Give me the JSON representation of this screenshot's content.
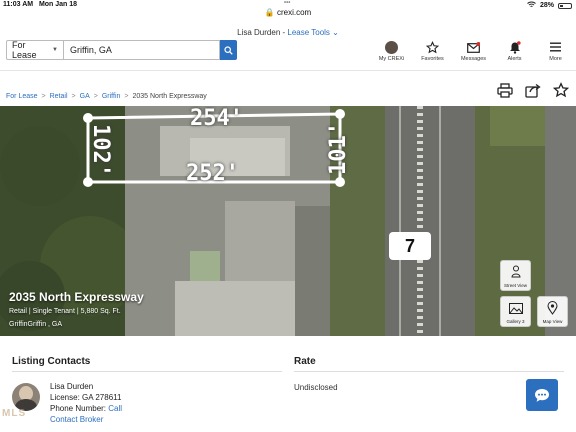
{
  "status_bar": {
    "time": "11:03 AM",
    "date": "Mon Jan 18",
    "url": "crexi.com",
    "battery": "28%"
  },
  "user_bar": {
    "name": "Lisa Durden",
    "sep": " - ",
    "tools": "Lease Tools"
  },
  "search": {
    "mode": "For Lease",
    "location_value": "Griffin, GA"
  },
  "nav": {
    "my_crexi": "My CREXi",
    "favorites": "Favorites",
    "messages": "Messages",
    "alerts": "Alerts",
    "more": "More"
  },
  "breadcrumb": {
    "items": [
      "For Lease",
      "Retail",
      "GA",
      "Griffin"
    ],
    "current": "2035 North Expressway"
  },
  "hero": {
    "dims": [
      "254'",
      "102'",
      "101'",
      "252'"
    ],
    "highway_shield": "7",
    "title": "2035 North Expressway",
    "subtitle": "Retail | Single Tenant | 5,880 Sq. Ft.",
    "location": "GriffinGriffin , GA",
    "street_view": "Street View",
    "gallery": "Gallery 3",
    "map_view": "Map View"
  },
  "contacts": {
    "heading": "Listing Contacts",
    "name": "Lisa Durden",
    "license": "License: GA 278611",
    "phone_label": "Phone Number: ",
    "phone_link": "Call",
    "broker_link": "Contact Broker",
    "mls_mark": "MLS"
  },
  "rate": {
    "heading": "Rate",
    "value": "Undisclosed"
  },
  "colors": {
    "accent": "#2c6fbf"
  }
}
